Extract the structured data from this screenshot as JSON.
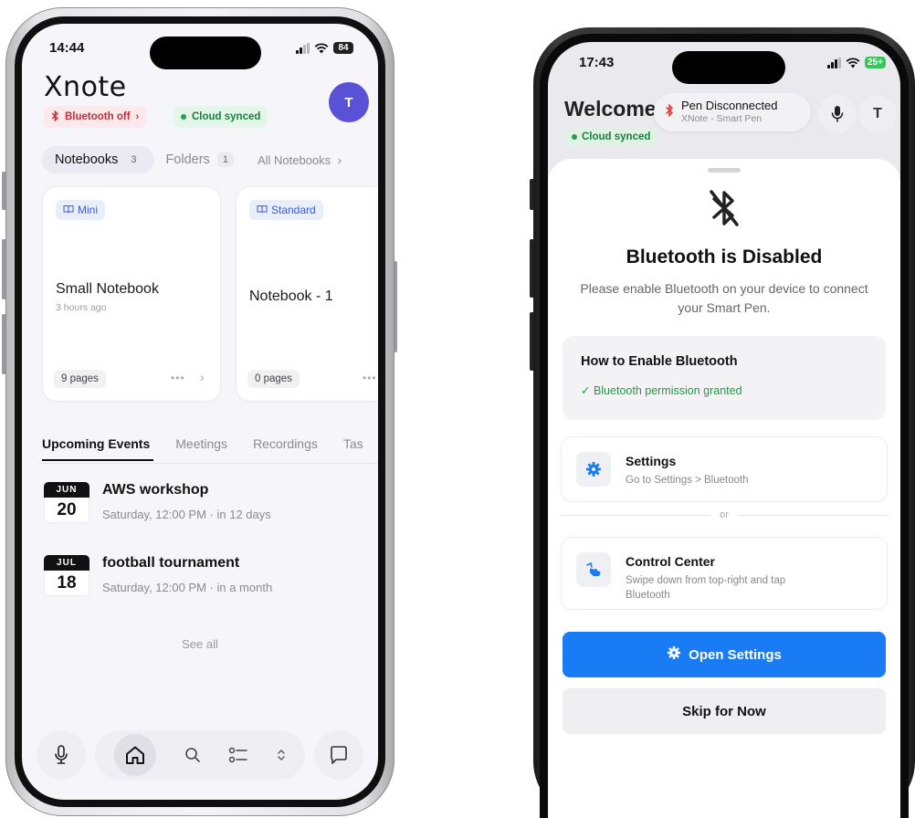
{
  "left": {
    "status": {
      "time": "14:44",
      "battery": "84"
    },
    "app_logo": "Xnote",
    "avatar_initial": "T",
    "chips": {
      "bluetooth": "Bluetooth off",
      "cloud": "Cloud synced"
    },
    "tabs": {
      "notebooks": {
        "label": "Notebooks",
        "count": "3"
      },
      "folders": {
        "label": "Folders",
        "count": "1"
      },
      "all": "All Notebooks"
    },
    "cards": [
      {
        "badge": "Mini",
        "title": "Small Notebook",
        "subtitle": "3 hours ago",
        "pages": "9 pages"
      },
      {
        "badge": "Standard",
        "title": "Notebook - 1",
        "pages": "0 pages"
      }
    ],
    "event_tabs": [
      "Upcoming Events",
      "Meetings",
      "Recordings",
      "Tas"
    ],
    "events": [
      {
        "month": "JUN",
        "day": "20",
        "title": "AWS workshop",
        "subtitle": "Saturday, 12:00 PM · in 12 days"
      },
      {
        "month": "JUL",
        "day": "18",
        "title": "football tournament",
        "subtitle": "Saturday, 12:00 PM · in a month"
      }
    ],
    "see_all": "See all",
    "dock_icons": [
      "microphone-icon",
      "home-icon",
      "search-icon",
      "checklist-icon",
      "chevron-updown-icon",
      "chat-icon"
    ]
  },
  "right": {
    "status": {
      "time": "17:43",
      "battery": "25+"
    },
    "welcome": "Welcome",
    "cloud": "Cloud synced",
    "pen": {
      "title": "Pen Disconnected",
      "subtitle": "XNote - Smart Pen"
    },
    "avatar_initial": "T",
    "sheet": {
      "title": "Bluetooth is Disabled",
      "description": "Please enable Bluetooth on your device to connect your Smart Pen.",
      "howto_title": "How to Enable Bluetooth",
      "howto_status": "✓ Bluetooth permission granted",
      "option_settings": {
        "title": "Settings",
        "subtitle": "Go to Settings > Bluetooth"
      },
      "or": "or",
      "option_control": {
        "title": "Control Center",
        "subtitle": "Swipe down from top-right and tap Bluetooth"
      },
      "open_settings": "Open Settings",
      "skip": "Skip for Now"
    }
  },
  "colors": {
    "accent_blue": "#1a7cf5",
    "avatar_purple": "#5a52d6",
    "bluetooth_red": "#c02d3c",
    "synced_green": "#17803d"
  }
}
